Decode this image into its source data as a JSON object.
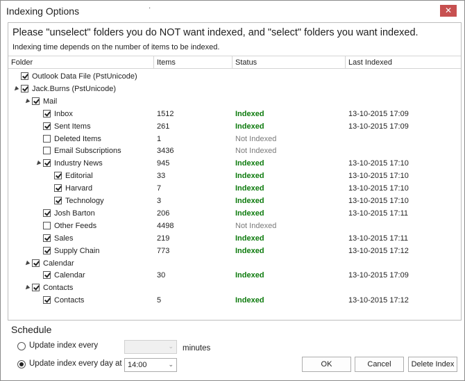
{
  "window": {
    "title": "Indexing Options",
    "dot_mark": "·"
  },
  "header": {
    "headline": "Please \"unselect\" folders you do NOT want indexed, and \"select\" folders you want indexed.",
    "subline": "Indexing time depends on the number of items to be indexed."
  },
  "table": {
    "columns": [
      "Folder",
      "Items",
      "Status",
      "Last Indexed"
    ],
    "rows": [
      {
        "name": "Outlook Data File (PstUnicode)",
        "level": 0,
        "expander": "",
        "checked": true,
        "items": "",
        "status": "",
        "last": ""
      },
      {
        "name": "Jack.Burns (PstUnicode)",
        "level": 0,
        "expander": "▲",
        "checked": true,
        "items": "",
        "status": "",
        "last": ""
      },
      {
        "name": "Mail",
        "level": 1,
        "expander": "▲",
        "checked": true,
        "items": "",
        "status": "",
        "last": ""
      },
      {
        "name": "Inbox",
        "level": 2,
        "expander": "",
        "checked": true,
        "items": "1512",
        "status": "Indexed",
        "last": "13-10-2015 17:09"
      },
      {
        "name": "Sent Items",
        "level": 2,
        "expander": "",
        "checked": true,
        "items": "261",
        "status": "Indexed",
        "last": "13-10-2015 17:09"
      },
      {
        "name": "Deleted Items",
        "level": 2,
        "expander": "",
        "checked": false,
        "items": "1",
        "status": "Not Indexed",
        "last": ""
      },
      {
        "name": "Email Subscriptions",
        "level": 2,
        "expander": "",
        "checked": false,
        "items": "3436",
        "status": "Not Indexed",
        "last": ""
      },
      {
        "name": "Industry News",
        "level": 2,
        "expander": "▲",
        "checked": true,
        "items": "945",
        "status": "Indexed",
        "last": "13-10-2015 17:10"
      },
      {
        "name": "Editorial",
        "level": 3,
        "expander": "",
        "checked": true,
        "items": "33",
        "status": "Indexed",
        "last": "13-10-2015 17:10"
      },
      {
        "name": "Harvard",
        "level": 3,
        "expander": "",
        "checked": true,
        "items": "7",
        "status": "Indexed",
        "last": "13-10-2015 17:10"
      },
      {
        "name": "Technology",
        "level": 3,
        "expander": "",
        "checked": true,
        "items": "3",
        "status": "Indexed",
        "last": "13-10-2015 17:10"
      },
      {
        "name": "Josh Barton",
        "level": 2,
        "expander": "",
        "checked": true,
        "items": "206",
        "status": "Indexed",
        "last": "13-10-2015 17:11"
      },
      {
        "name": "Other Feeds",
        "level": 2,
        "expander": "",
        "checked": false,
        "items": "4498",
        "status": "Not Indexed",
        "last": ""
      },
      {
        "name": "Sales",
        "level": 2,
        "expander": "",
        "checked": true,
        "items": "219",
        "status": "Indexed",
        "last": "13-10-2015 17:11"
      },
      {
        "name": "Supply Chain",
        "level": 2,
        "expander": "",
        "checked": true,
        "items": "773",
        "status": "Indexed",
        "last": "13-10-2015 17:12"
      },
      {
        "name": "Calendar",
        "level": 1,
        "expander": "▲",
        "checked": true,
        "items": "",
        "status": "",
        "last": ""
      },
      {
        "name": "Calendar",
        "level": 2,
        "expander": "",
        "checked": true,
        "items": "30",
        "status": "Indexed",
        "last": "13-10-2015 17:09"
      },
      {
        "name": "Contacts",
        "level": 1,
        "expander": "▲",
        "checked": true,
        "items": "",
        "status": "",
        "last": ""
      },
      {
        "name": "Contacts",
        "level": 2,
        "expander": "",
        "checked": true,
        "items": "5",
        "status": "Indexed",
        "last": "13-10-2015 17:12"
      }
    ]
  },
  "schedule": {
    "title": "Schedule",
    "option_every": "Update index every",
    "option_every_selected": false,
    "minutes_value": "",
    "minutes_label": "minutes",
    "option_daily": "Update index every day at",
    "option_daily_selected": true,
    "time_value": "14:00"
  },
  "buttons": {
    "ok": "OK",
    "cancel": "Cancel",
    "delete_index": "Delete Index"
  },
  "icons": {
    "close": "close-icon",
    "expander": "triangle-expander-icon",
    "dropdown": "chevron-down-icon"
  },
  "colors": {
    "indexed": "#0c7a0c",
    "not_indexed": "#7a7a7a",
    "close_button": "#c75050"
  }
}
